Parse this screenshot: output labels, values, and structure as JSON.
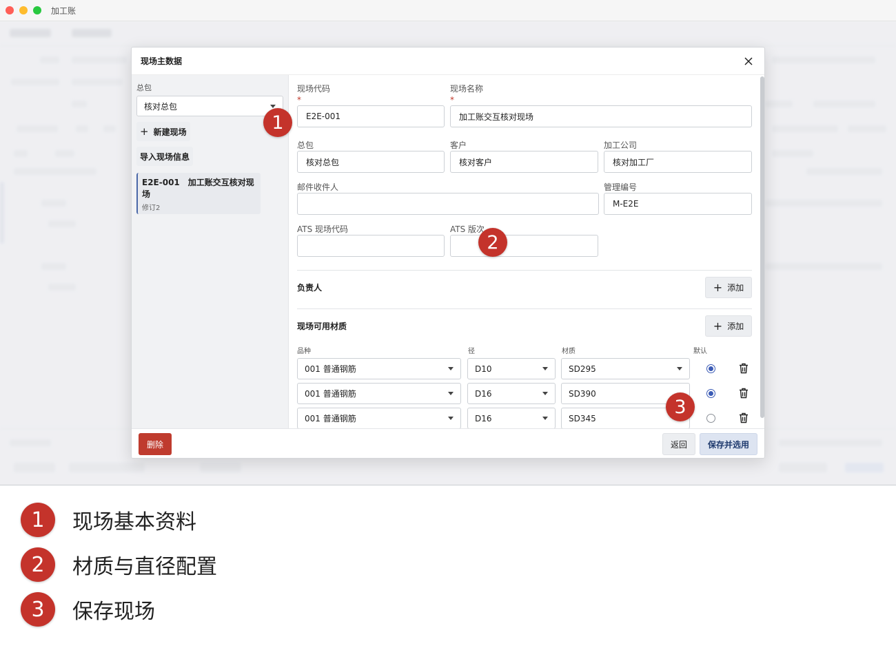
{
  "window": {
    "title": "加工账"
  },
  "modal": {
    "title": "现场主数据",
    "left": {
      "general_label": "总包",
      "general_value": "核对总包",
      "new_site": "新建现场",
      "import_site": "导入现场信息",
      "sites": [
        {
          "code": "E2E-001",
          "name": "加工账交互核对现场",
          "revision": "修订2"
        }
      ]
    },
    "form": {
      "site_code": {
        "label": "现场代码",
        "value": "E2E-001",
        "required": "*"
      },
      "site_name": {
        "label": "现场名称",
        "value": "加工账交互核对现场",
        "required": "*"
      },
      "general": {
        "label": "总包",
        "value": "核对总包"
      },
      "customer": {
        "label": "客户",
        "value": "核对客户"
      },
      "processor": {
        "label": "加工公司",
        "value": "核对加工厂"
      },
      "mail_recipient": {
        "label": "邮件收件人",
        "value": ""
      },
      "management_no": {
        "label": "管理编号",
        "value": "M-E2E"
      },
      "ats_site_code": {
        "label": "ATS 现场代码",
        "value": ""
      },
      "ats_version": {
        "label": "ATS 版次",
        "value": ""
      }
    },
    "owner_section": {
      "title": "负责人",
      "add_label": "添加"
    },
    "materials_section": {
      "title": "现场可用材质",
      "add_label": "添加",
      "columns": {
        "kind": "品种",
        "diameter": "径",
        "grade": "材质",
        "default": "默认"
      },
      "rows": [
        {
          "kind": "001 普通钢筋",
          "diameter": "D10",
          "grade": "SD295",
          "default": true
        },
        {
          "kind": "001 普通钢筋",
          "diameter": "D16",
          "grade": "SD390",
          "default": true
        },
        {
          "kind": "001 普通钢筋",
          "diameter": "D16",
          "grade": "SD345",
          "default": false
        }
      ]
    },
    "footer": {
      "delete": "删除",
      "back": "返回",
      "save": "保存并选用"
    }
  },
  "callouts": [
    {
      "num": "1",
      "text": "现场基本资料"
    },
    {
      "num": "2",
      "text": "材质与直径配置"
    },
    {
      "num": "3",
      "text": "保存现场"
    }
  ],
  "colors": {
    "accent": "#3b5bb5",
    "danger": "#bf3b2e",
    "marker": "#c4332b"
  }
}
